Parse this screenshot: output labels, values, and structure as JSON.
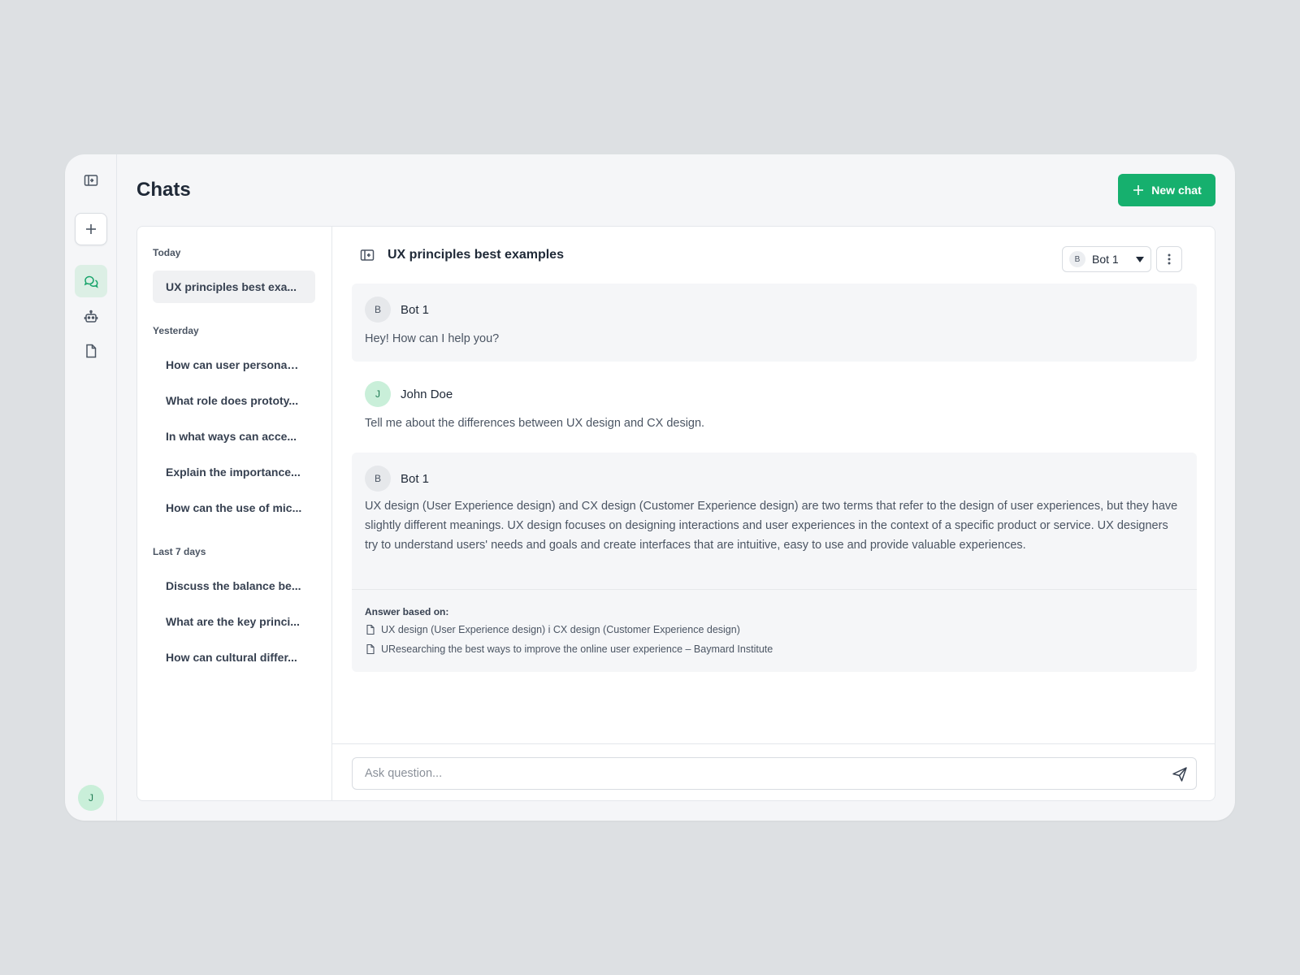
{
  "app": {
    "title": "Chats"
  },
  "rail": {
    "icons": [
      "collapse-sidebar-icon",
      "plus-icon",
      "chat-bubbles-icon",
      "robot-icon",
      "document-icon"
    ],
    "user_initial": "J"
  },
  "header": {
    "new_chat_label": "New chat"
  },
  "history": {
    "groups": [
      {
        "label": "Today",
        "items": [
          "UX principles best exa..."
        ]
      },
      {
        "label": "Yesterday",
        "items": [
          "How can user personas...",
          "What role does prototy...",
          "In what ways can acce...",
          "Explain the importance...",
          "How can the use of mic..."
        ]
      },
      {
        "label": "Last 7 days",
        "items": [
          "Discuss the balance be...",
          "What are the key princi...",
          "How can cultural differ..."
        ]
      }
    ],
    "active_item": "UX principles best exa..."
  },
  "chat": {
    "title": "UX principles best examples",
    "bot_select": {
      "initial": "B",
      "value": "Bot 1"
    },
    "messages": [
      {
        "role": "bot",
        "initial": "B",
        "author": "Bot 1",
        "text": "Hey! How can I help you?"
      },
      {
        "role": "user",
        "initial": "J",
        "author": "John Doe",
        "text": "Tell me about the differences between UX design and CX design."
      },
      {
        "role": "bot",
        "initial": "B",
        "author": "Bot 1",
        "text": "UX design (User Experience design) and CX design (Customer Experience design) are two terms that refer to the design of user experiences, but they have slightly different meanings. UX design focuses on designing interactions and user experiences in the context of a specific product or service. UX designers try to understand users' needs and goals and create interfaces that are intuitive, easy to use and provide valuable experiences.",
        "sources_label": "Answer based on:",
        "sources": [
          "UX design (User Experience design) i CX design (Customer Experience design)",
          "UResearching the best ways to improve the online user experience – Baymard Institute"
        ]
      }
    ],
    "input": {
      "placeholder": "Ask question...",
      "value": ""
    }
  },
  "colors": {
    "accent": "#16b06e",
    "accent_light": "#dcefe5",
    "background": "#dde0e3"
  }
}
